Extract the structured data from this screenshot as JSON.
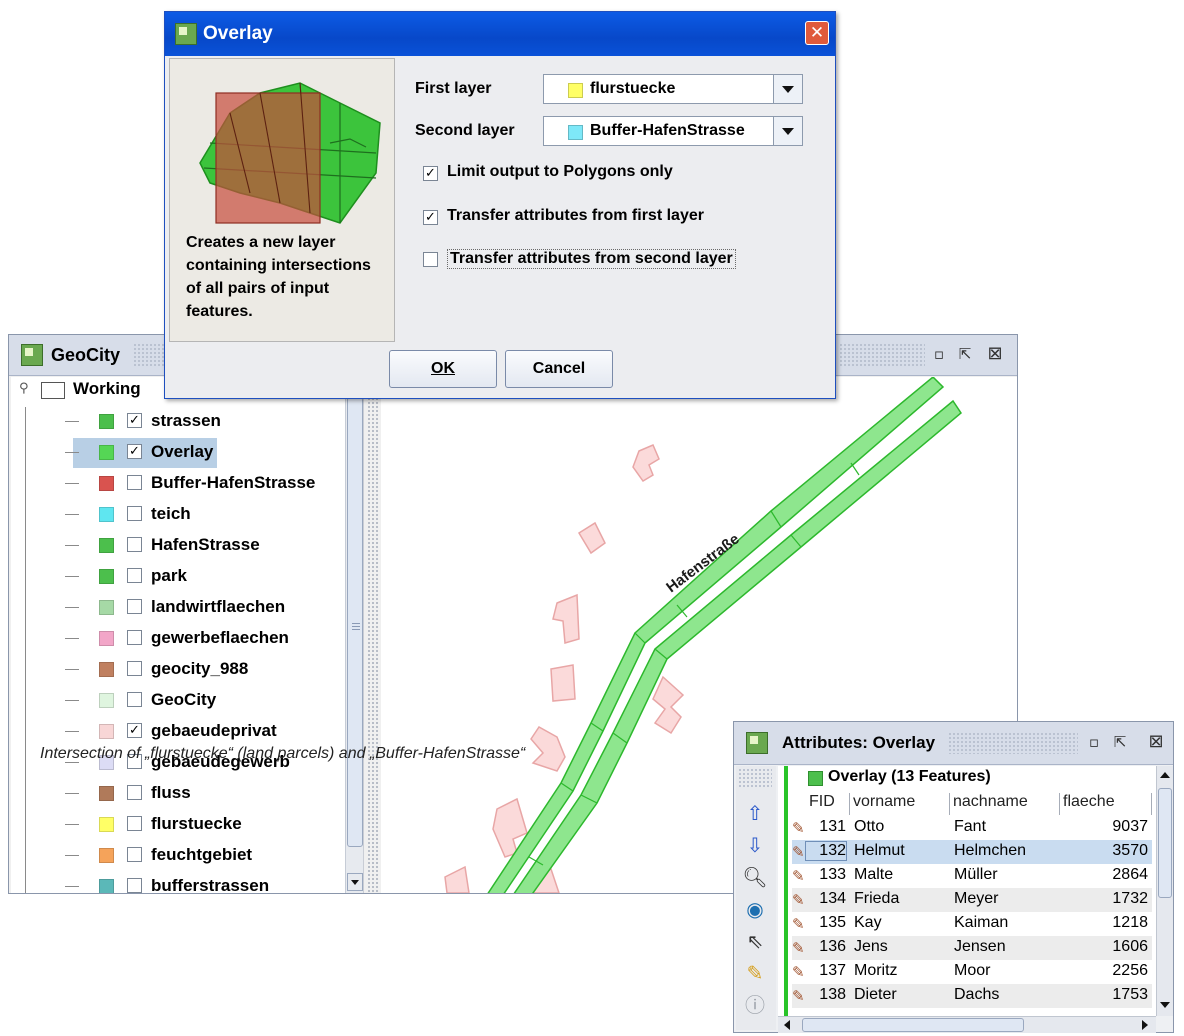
{
  "main_window": {
    "title": "GeoCity",
    "tree_root": "Working",
    "layers": [
      {
        "name": "strassen",
        "color": "#4cbf4c",
        "checked": true,
        "selected": false
      },
      {
        "name": "Overlay",
        "color": "#55d655",
        "checked": true,
        "selected": true
      },
      {
        "name": "Buffer-HafenStrasse",
        "color": "#d9534f",
        "checked": false,
        "selected": false
      },
      {
        "name": "teich",
        "color": "#5fe6f0",
        "checked": false,
        "selected": false
      },
      {
        "name": "HafenStrasse",
        "color": "#4cbf4c",
        "checked": false,
        "selected": false
      },
      {
        "name": "park",
        "color": "#4cbf4c",
        "checked": false,
        "selected": false
      },
      {
        "name": "landwirtflaechen",
        "color": "#a6d9a6",
        "checked": false,
        "selected": false
      },
      {
        "name": "gewerbeflaechen",
        "color": "#f2a6c8",
        "checked": false,
        "selected": false
      },
      {
        "name": "geocity_988",
        "color": "#c08060",
        "checked": false,
        "selected": false
      },
      {
        "name": "GeoCity",
        "color": "#dff5df",
        "checked": false,
        "selected": false
      },
      {
        "name": "gebaeudeprivat",
        "color": "#f8d6d6",
        "checked": true,
        "selected": false
      },
      {
        "name": "gebaeudegewerb",
        "color": "#dcdcf5",
        "checked": false,
        "selected": false
      },
      {
        "name": "fluss",
        "color": "#b07a5a",
        "checked": false,
        "selected": false
      },
      {
        "name": "flurstuecke",
        "color": "#ffff66",
        "checked": false,
        "selected": false
      },
      {
        "name": "feuchtgebiet",
        "color": "#f5a35a",
        "checked": false,
        "selected": false
      },
      {
        "name": "bufferstrassen",
        "color": "#5bb8b8",
        "checked": false,
        "selected": false
      }
    ],
    "map_street_label": "Hafenstraße"
  },
  "dialog": {
    "title": "Overlay",
    "description": "Creates a new layer containing intersections of all pairs of input features.",
    "first_layer_label": "First layer",
    "first_layer_value": "flurstuecke",
    "first_layer_color": "#ffff66",
    "second_layer_label": "Second layer",
    "second_layer_value": "Buffer-HafenStrasse",
    "second_layer_color": "#7ee8f8",
    "options": [
      {
        "label": "Limit output to Polygons only",
        "checked": true
      },
      {
        "label": "Transfer attributes from first layer",
        "checked": true
      },
      {
        "label": "Transfer attributes from second layer",
        "checked": false
      }
    ],
    "ok_label": "OK",
    "cancel_label": "Cancel"
  },
  "attributes_window": {
    "title": "Attributes: Overlay",
    "layer_header": "Overlay (13 Features)",
    "columns": [
      "FID",
      "vorname",
      "nachname",
      "flaeche"
    ],
    "rows": [
      {
        "fid": "131",
        "vorname": "Otto",
        "nachname": "Fant",
        "flaeche": "9037",
        "selected": false
      },
      {
        "fid": "132",
        "vorname": "Helmut",
        "nachname": "Helmchen",
        "flaeche": "3570",
        "selected": true
      },
      {
        "fid": "133",
        "vorname": "Malte",
        "nachname": "Müller",
        "flaeche": "2864",
        "selected": false
      },
      {
        "fid": "134",
        "vorname": "Frieda",
        "nachname": "Meyer",
        "flaeche": "1732",
        "selected": false
      },
      {
        "fid": "135",
        "vorname": "Kay",
        "nachname": "Kaiman",
        "flaeche": "1218",
        "selected": false
      },
      {
        "fid": "136",
        "vorname": "Jens",
        "nachname": "Jensen",
        "flaeche": "1606",
        "selected": false
      },
      {
        "fid": "137",
        "vorname": "Moritz",
        "nachname": "Moor",
        "flaeche": "2256",
        "selected": false
      },
      {
        "fid": "138",
        "vorname": "Dieter",
        "nachname": "Dachs",
        "flaeche": "1753",
        "selected": false
      }
    ]
  },
  "caption": "Intersection of  „flurstuecke“ (land parcels) and „Buffer-HafenStrasse“"
}
